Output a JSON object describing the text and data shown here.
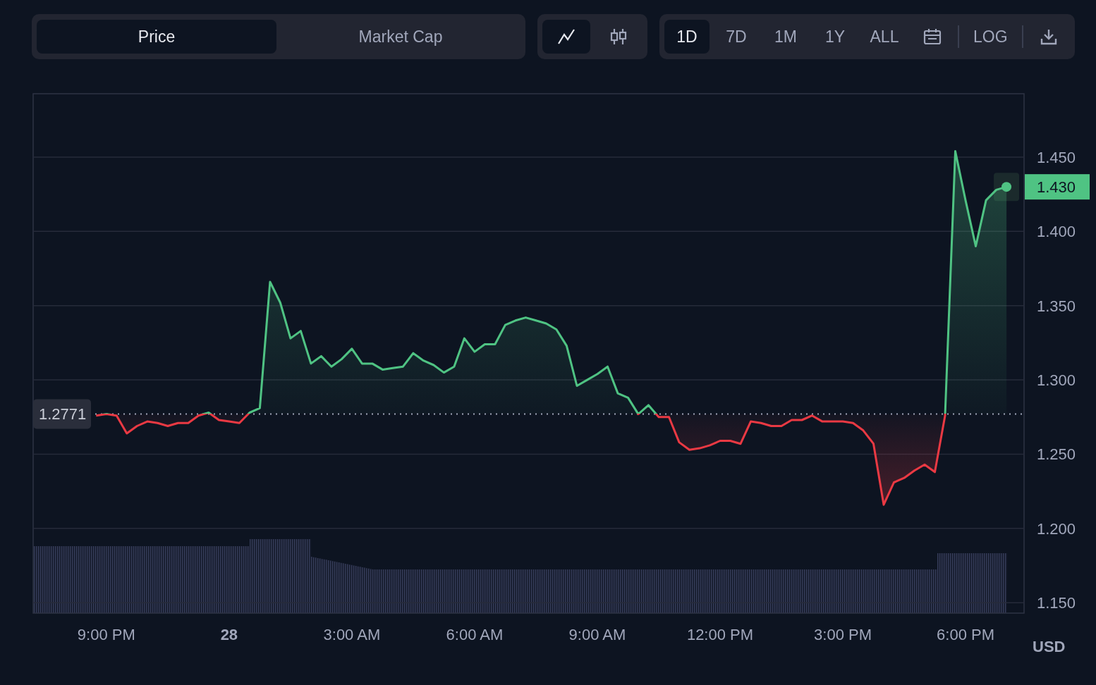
{
  "metric_tabs": [
    {
      "label": "Price",
      "selected": true
    },
    {
      "label": "Market Cap",
      "selected": false
    }
  ],
  "chart_types": [
    {
      "kind": "line",
      "selected": true
    },
    {
      "kind": "candles",
      "selected": false
    }
  ],
  "ranges": [
    {
      "label": "1D",
      "selected": true
    },
    {
      "label": "7D",
      "selected": false
    },
    {
      "label": "1M",
      "selected": false
    },
    {
      "label": "1Y",
      "selected": false
    },
    {
      "label": "ALL",
      "selected": false
    }
  ],
  "log_button": "LOG",
  "chart": {
    "chart_data": {
      "type": "area",
      "ylabel": "USD",
      "grid": true,
      "ylim": [
        1.143,
        1.4927
      ],
      "categories": [
        null,
        "9:00 PM",
        null,
        null,
        null,
        null,
        null,
        null,
        null,
        null,
        null,
        null,
        null,
        "28",
        null,
        null,
        null,
        null,
        null,
        null,
        null,
        null,
        null,
        null,
        null,
        "3:00 AM",
        null,
        null,
        null,
        null,
        null,
        null,
        null,
        null,
        null,
        null,
        null,
        "6:00 AM",
        null,
        null,
        null,
        null,
        null,
        null,
        null,
        null,
        null,
        null,
        null,
        "9:00 AM",
        null,
        null,
        null,
        null,
        null,
        null,
        null,
        null,
        null,
        null,
        null,
        "12:00 PM",
        null,
        null,
        null,
        null,
        null,
        null,
        null,
        null,
        null,
        null,
        null,
        "3:00 PM",
        null,
        null,
        null,
        null,
        null,
        null,
        null,
        null,
        null,
        null,
        null,
        "6:00 PM",
        null,
        null,
        null,
        null
      ],
      "series": [
        {
          "color": "#4fc383",
          "values": [
            1.276,
            1.277,
            1.276,
            1.264,
            1.269,
            1.272,
            1.271,
            1.269,
            1.271,
            1.271,
            1.276,
            1.278,
            1.273,
            1.272,
            1.271,
            1.278,
            1.281,
            1.366,
            1.352,
            1.328,
            1.333,
            1.311,
            1.316,
            1.309,
            1.314,
            1.321,
            1.311,
            1.311,
            1.307,
            1.308,
            1.309,
            1.318,
            1.313,
            1.31,
            1.305,
            1.309,
            1.328,
            1.319,
            1.324,
            1.324,
            1.337,
            1.34,
            1.342,
            1.34,
            1.338,
            1.334,
            1.323,
            1.296,
            1.3,
            1.304,
            1.309,
            1.291,
            1.288,
            1.277,
            1.283,
            1.275,
            1.275,
            1.258,
            1.253,
            1.254,
            1.256,
            1.259,
            1.259,
            1.257,
            1.272,
            1.271,
            1.269,
            1.269,
            1.273,
            1.273,
            1.276,
            1.272,
            1.272,
            1.272,
            1.271,
            1.266,
            1.257,
            1.216,
            1.231,
            1.234,
            1.239,
            1.243,
            1.238,
            1.276,
            1.454,
            1.421,
            1.39,
            1.421,
            1.428,
            1.43
          ]
        }
      ],
      "yticks": [
        {
          "value": 1.15,
          "label": "1.150"
        },
        {
          "value": 1.2,
          "label": "1.200"
        },
        {
          "value": 1.25,
          "label": "1.250"
        },
        {
          "value": 1.3,
          "label": "1.300"
        },
        {
          "value": 1.35,
          "label": "1.350"
        },
        {
          "value": 1.4,
          "label": "1.400"
        },
        {
          "value": 1.45,
          "label": "1.450"
        }
      ],
      "ref_lines": [
        {
          "axis": "y",
          "value": 1.2771,
          "label": "1.2771"
        }
      ],
      "annotations": [
        "1.430"
      ]
    }
  }
}
